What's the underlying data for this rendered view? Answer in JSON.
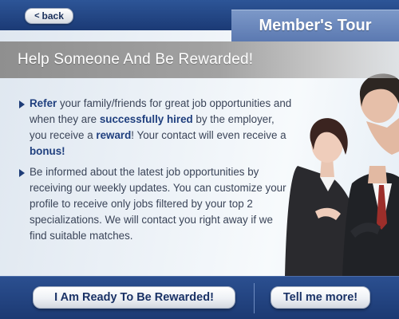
{
  "header": {
    "back_label": "back",
    "tour_label": "Member's Tour"
  },
  "main": {
    "headline": "Help Someone And Be Rewarded!",
    "bullet1": {
      "p1": "Refer",
      "p2": " your family/friends for great job opportunities and when they are ",
      "p3": "successfully hired",
      "p4": " by the employer, you receive a ",
      "p5": "reward",
      "p6": "! Your contact will even receive a ",
      "p7": "bonus!"
    },
    "bullet2": "Be informed about the latest job opportunities by receiving our weekly updates. You can customize your profile to receive only jobs filtered by your top 2 specializations. We will contact you right away if we find suitable matches."
  },
  "footer": {
    "reward_button": "I Am Ready To Be Rewarded!",
    "more_button": "Tell me more!"
  },
  "colors": {
    "navy": "#1f3f7a",
    "accent_text": "#1f3f7e",
    "tour_tag": "#6b88bf"
  }
}
